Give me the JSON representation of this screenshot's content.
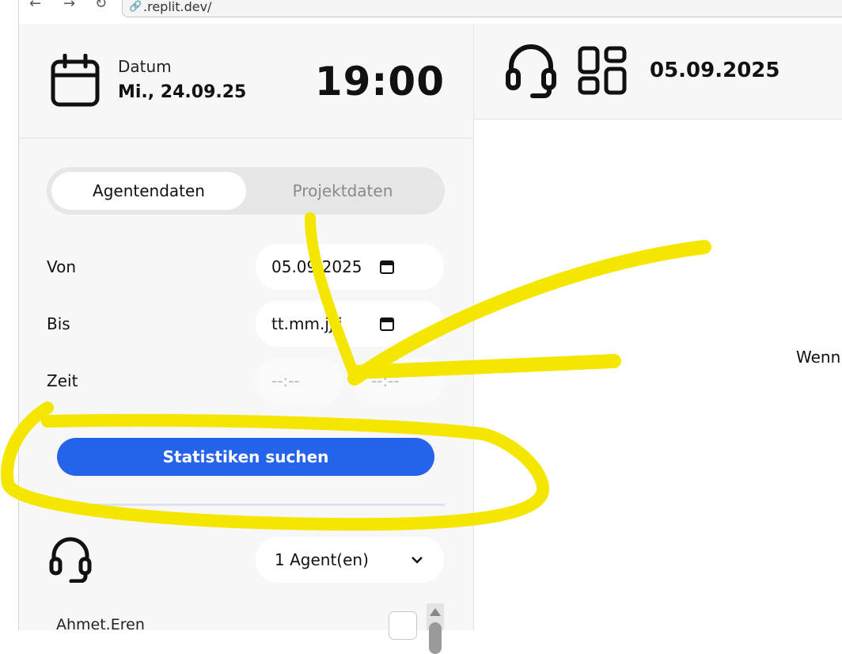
{
  "browser": {
    "back_icon": "arrow-left-icon",
    "forward_icon": "arrow-right-icon",
    "reload_icon": "reload-icon",
    "url": ".replit.dev/"
  },
  "sidebar": {
    "date_label": "Datum",
    "date_value": "Mi., 24.09.25",
    "clock": "19:00",
    "tabs": [
      {
        "label": "Agentendaten",
        "active": true
      },
      {
        "label": "Projektdaten",
        "active": false
      }
    ],
    "form": {
      "von_label": "Von",
      "von_value": "05.09.2025",
      "bis_label": "Bis",
      "bis_value": "tt.mm.jjjj",
      "zeit_label": "Zeit",
      "zeit_from": "--:--",
      "zeit_to": "--:--"
    },
    "search_button": "Statistiken suchen",
    "agent_select": "1 Agent(en)",
    "agent_name": "Ahmet.Eren"
  },
  "main": {
    "header_date": "05.09.2025",
    "partial_text": "Wenn"
  },
  "colors": {
    "primary": "#2563eb",
    "annotation": "#f5e600",
    "panel_bg": "#f6f7f6"
  }
}
